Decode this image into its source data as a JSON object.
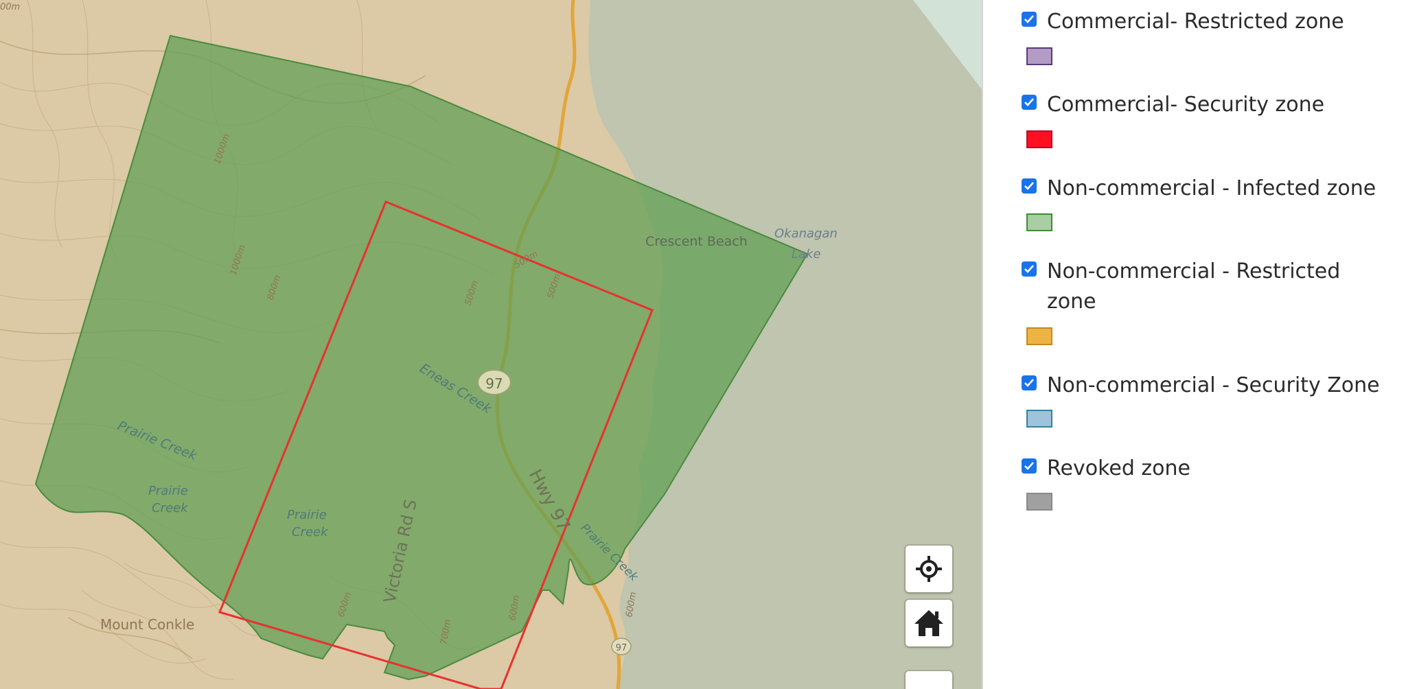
{
  "map": {
    "place_labels": {
      "crescent_beach": "Crescent Beach",
      "okanagan_lake_1": "Okanagan",
      "okanagan_lake_2": "Lake",
      "mount_conkle": "Mount Conkle",
      "eneas_creek": "Eneas Creek",
      "prairie_creek_1": "Prairie Creek",
      "prairie_creek_2": "Prairie",
      "prairie_creek_2b": "Creek",
      "prairie_creek_3": "Prairie",
      "prairie_creek_3b": "Creek",
      "prairie_creek_4": "Prairie Creek",
      "hwy_97_road": "Hwy 97",
      "hwy_97_shield": "97",
      "hwy_97_shield_2": "97",
      "victoria_rd": "Victoria Rd S",
      "contour_1000m": "1000m",
      "contour_600m_a": "600m",
      "contour_800m": "800m",
      "contour_1000m_b": "1000m",
      "contour_500m_a": "500m",
      "contour_500m_b": "500m",
      "contour_500m_c": "500m",
      "contour_600m_b": "600m",
      "contour_700m": "700m",
      "contour_600m_c": "600m",
      "contour_00m": "00m"
    },
    "colors": {
      "land": "#dcc9a6",
      "water": "#bfc5ae",
      "infected_zone_fill": "#5f9e53",
      "infected_zone_stroke": "#4a8a3f",
      "security_zone_stroke": "#e8312f"
    },
    "controls": {
      "locate_icon": "crosshair-icon",
      "home_icon": "home-icon"
    }
  },
  "legend": {
    "items": [
      {
        "label": "Commercial- Restricted zone",
        "checked": true,
        "fill": "#b39cc4",
        "border": "#5b3a78"
      },
      {
        "label": "Commercial- Security zone",
        "checked": true,
        "fill": "#ff1020",
        "border": "#b3102a"
      },
      {
        "label": "Non-commercial - Infected zone",
        "checked": true,
        "fill": "#a8cfa1",
        "border": "#3f8a3a"
      },
      {
        "label": "Non-commercial - Restricted zone",
        "checked": true,
        "fill": "#ecb443",
        "border": "#c58a1b"
      },
      {
        "label": "Non-commercial - Security Zone",
        "checked": true,
        "fill": "#9ec3db",
        "border": "#3a7ca6"
      },
      {
        "label": "Revoked zone",
        "checked": true,
        "fill": "#a0a0a0",
        "border": "#8a8a8a"
      }
    ]
  }
}
